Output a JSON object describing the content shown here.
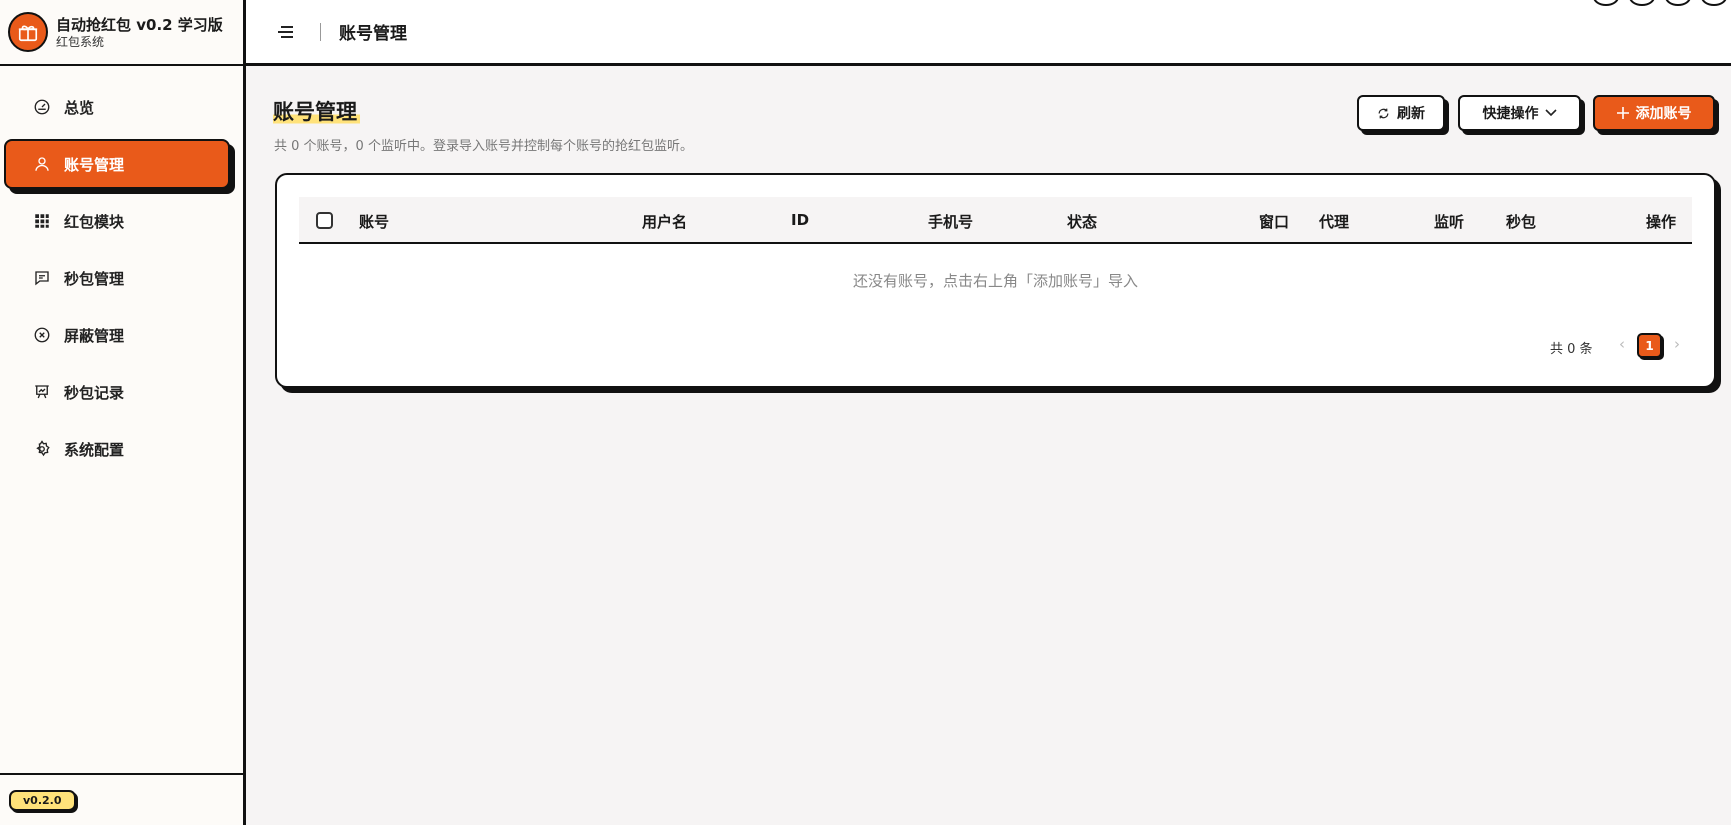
{
  "brand": {
    "title": "自动抢红包 v0.2 学习版",
    "subtitle": "红包系统"
  },
  "nav": [
    {
      "label": "总览",
      "icon": "gauge-icon"
    },
    {
      "label": "账号管理",
      "icon": "user-icon",
      "active": true
    },
    {
      "label": "红包模块",
      "icon": "grid-icon"
    },
    {
      "label": "秒包管理",
      "icon": "message-icon"
    },
    {
      "label": "屏蔽管理",
      "icon": "block-icon"
    },
    {
      "label": "秒包记录",
      "icon": "chart-board-icon"
    },
    {
      "label": "系统配置",
      "icon": "gear-icon"
    }
  ],
  "version": "v0.2.0",
  "header": {
    "title": "账号管理"
  },
  "page": {
    "title": "账号管理",
    "subtitle": "共 0 个账号，0 个监听中。登录导入账号并控制每个账号的抢红包监听。"
  },
  "actions": {
    "refresh": "刷新",
    "quick": "快捷操作",
    "add": "添加账号"
  },
  "table": {
    "columns": [
      "账号",
      "用户名",
      "ID",
      "手机号",
      "状态",
      "窗口",
      "代理",
      "监听",
      "秒包",
      "操作"
    ],
    "empty": "还没有账号，点击右上角「添加账号」导入"
  },
  "pagination": {
    "total": "共 0 条",
    "current": "1"
  },
  "colors": {
    "accent": "#e95a1a",
    "highlight": "#ffe27a",
    "border": "#111111"
  }
}
